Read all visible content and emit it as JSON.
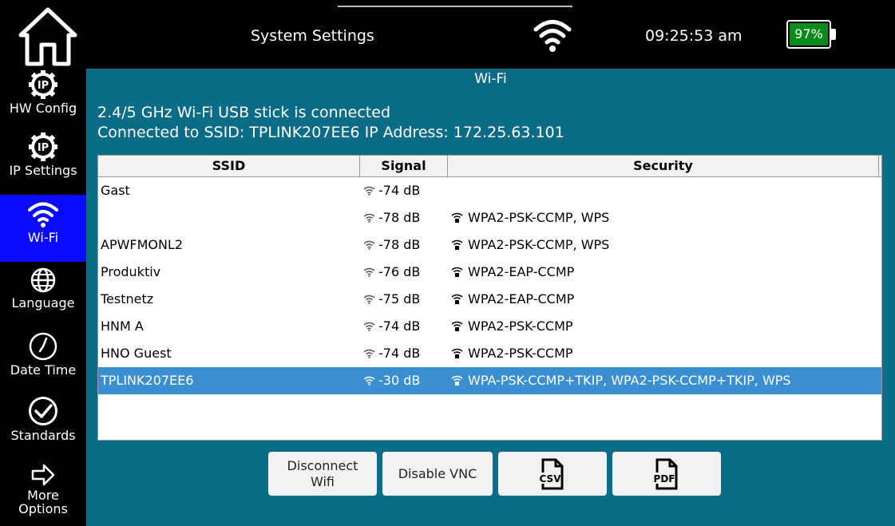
{
  "header": {
    "title": "System Settings",
    "time": "09:25:53 am",
    "battery": "97%",
    "battery_color": "#0a8a1a",
    "home_icon": "home-icon",
    "wifi_icon": "wifi-icon"
  },
  "sidebar": {
    "items": [
      {
        "label": "HW Config",
        "icon": "ip-gear-icon"
      },
      {
        "label": "IP Settings",
        "icon": "ip-gear-icon"
      },
      {
        "label": "Wi-Fi",
        "icon": "wifi-icon",
        "active": true
      },
      {
        "label": "Language",
        "icon": "globe-icon"
      },
      {
        "label": "Date Time",
        "icon": "clock-icon"
      },
      {
        "label": "Standards",
        "icon": "check-circle-icon"
      },
      {
        "label": "More",
        "label2": "Options",
        "icon": "arrow-right-icon"
      }
    ],
    "active_color": "#0a0aff"
  },
  "main": {
    "section_title": "Wi-Fi",
    "status_line1": "2.4/5 GHz Wi-Fi USB stick is connected",
    "status_line2": "Connected to SSID: TPLINK207EE6 IP Address: 172.25.63.101",
    "background": "#0b6c87"
  },
  "table": {
    "columns": [
      "SSID",
      "Signal",
      "Security"
    ],
    "rows": [
      {
        "ssid": "Gast",
        "signal": "-74 dB",
        "security": ""
      },
      {
        "ssid": "",
        "signal": "-78 dB",
        "security": "WPA2-PSK-CCMP, WPS"
      },
      {
        "ssid": "APWFMONL2",
        "signal": "-78 dB",
        "security": "WPA2-PSK-CCMP, WPS"
      },
      {
        "ssid": "Produktiv",
        "signal": "-76 dB",
        "security": "WPA2-EAP-CCMP"
      },
      {
        "ssid": "Testnetz",
        "signal": "-75 dB",
        "security": "WPA2-EAP-CCMP"
      },
      {
        "ssid": "HNM A",
        "signal": "-74 dB",
        "security": "WPA2-PSK-CCMP"
      },
      {
        "ssid": "HNO Guest",
        "signal": "-74 dB",
        "security": "WPA2-PSK-CCMP"
      },
      {
        "ssid": "TPLINK207EE6",
        "signal": "-30 dB",
        "security": "WPA-PSK-CCMP+TKIP, WPA2-PSK-CCMP+TKIP, WPS",
        "selected": true
      }
    ],
    "selected_color": "#3a8fd0"
  },
  "buttons": {
    "disconnect_line1": "Disconnect",
    "disconnect_line2": "Wifi",
    "disable_vnc": "Disable VNC",
    "csv_icon": "csv-file-icon",
    "csv_text": "CSV",
    "pdf_icon": "pdf-file-icon",
    "pdf_text": "PDF"
  }
}
